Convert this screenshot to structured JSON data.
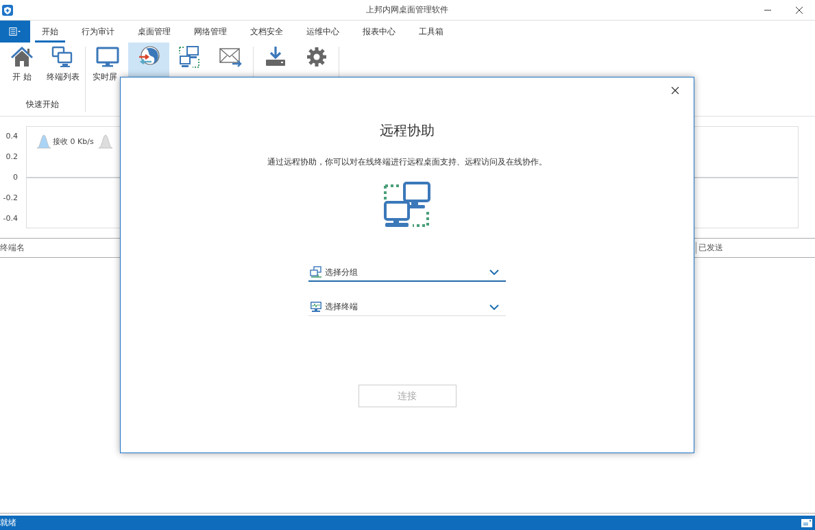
{
  "window": {
    "title": "上邦内网桌面管理软件"
  },
  "tabs": [
    {
      "label": "开始",
      "selected": true
    },
    {
      "label": "行为审计",
      "selected": false
    },
    {
      "label": "桌面管理",
      "selected": false
    },
    {
      "label": "网络管理",
      "selected": false
    },
    {
      "label": "文档安全",
      "selected": false
    },
    {
      "label": "运维中心",
      "selected": false
    },
    {
      "label": "报表中心",
      "selected": false
    },
    {
      "label": "工具箱",
      "selected": false
    }
  ],
  "ribbon": {
    "groups": [
      {
        "label": "快速开始",
        "items": [
          {
            "label": "开 始",
            "selected": false
          },
          {
            "label": "终端列表",
            "selected": false
          }
        ]
      },
      {
        "items": [
          {
            "label": "实时屏",
            "selected": false
          },
          {
            "selected": true
          },
          {
            "selected": false
          },
          {
            "selected": false
          }
        ]
      },
      {
        "items": [
          {
            "selected": false
          },
          {
            "selected": false
          }
        ]
      }
    ]
  },
  "traffic_chart": {
    "y_labels": [
      "0.4",
      "0.2",
      "0",
      "-0.2",
      "-0.4"
    ],
    "legend": [
      {
        "label": "接收 0 Kb/s",
        "color": "#a9d4f5"
      },
      {
        "color": "#dddddd"
      }
    ]
  },
  "table": {
    "columns": [
      "终端名",
      "已发送"
    ]
  },
  "dialog": {
    "title": "远程协助",
    "description": "通过远程协助，你可以对在线终端进行远程桌面支持、远程访问及在线协作。",
    "dropdowns": [
      {
        "placeholder": "选择分组",
        "focused": true
      },
      {
        "placeholder": "选择终端",
        "focused": false
      }
    ],
    "button": {
      "label": "连接",
      "disabled": true
    }
  },
  "status_bar": {
    "text": "就绪"
  }
}
